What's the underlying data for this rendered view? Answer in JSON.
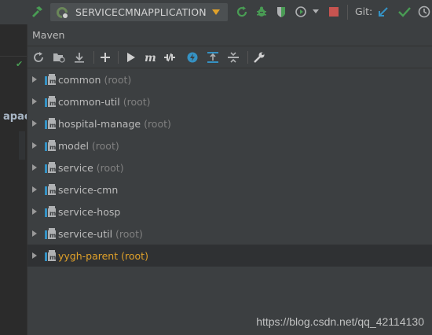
{
  "toolbar": {
    "run_config": "SERVICECMNAPPLICATION",
    "git_label": "Git:"
  },
  "editor": {
    "fragment": "apac"
  },
  "maven": {
    "title": "Maven",
    "projects": [
      {
        "name": "common",
        "suffix": "(root)"
      },
      {
        "name": "common-util",
        "suffix": "(root)"
      },
      {
        "name": "hospital-manage",
        "suffix": "(root)"
      },
      {
        "name": "model",
        "suffix": "(root)"
      },
      {
        "name": "service",
        "suffix": "(root)"
      },
      {
        "name": "service-cmn",
        "suffix": ""
      },
      {
        "name": "service-hosp",
        "suffix": ""
      },
      {
        "name": "service-util",
        "suffix": "(root)"
      },
      {
        "name": "yygh-parent",
        "suffix": "(root)"
      }
    ]
  },
  "watermark": "https://blog.csdn.net/qq_42114130",
  "colors": {
    "accent_orange": "#e0a12a",
    "green": "#499c54",
    "blue": "#3592c4",
    "red": "#c75450"
  }
}
